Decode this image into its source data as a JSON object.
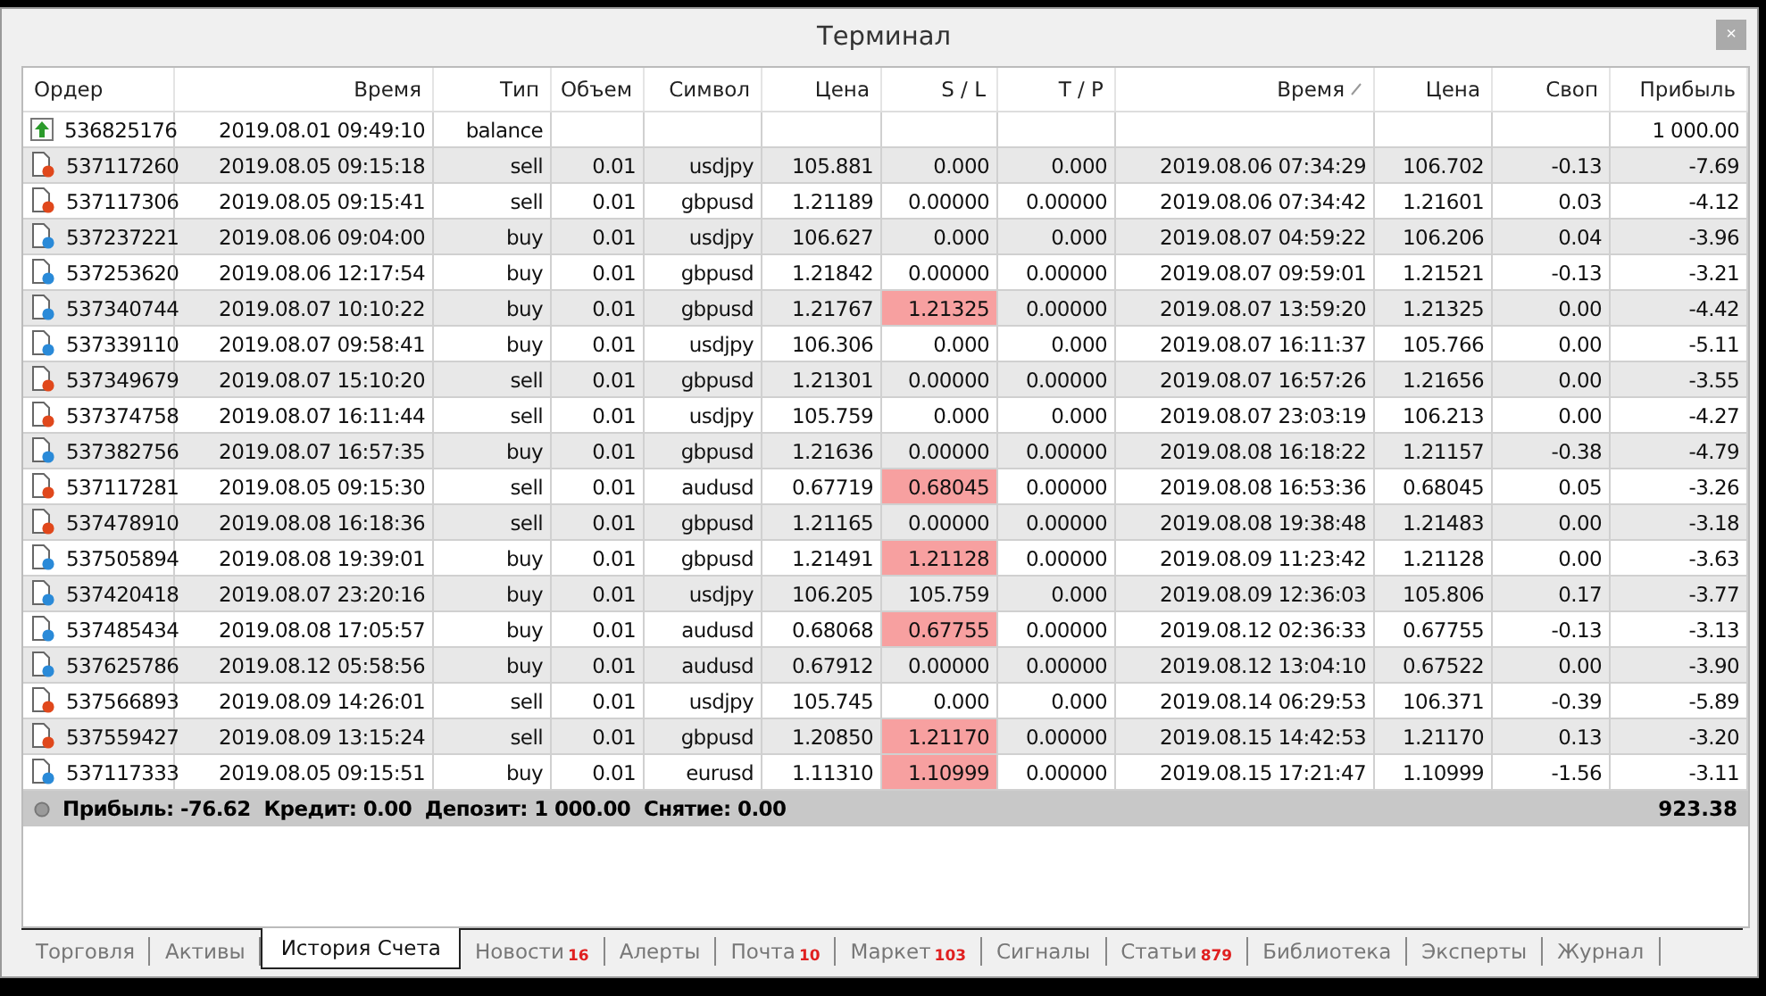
{
  "window": {
    "title": "Терминал",
    "close": "×"
  },
  "columns": [
    {
      "label": "Ордер",
      "sorted": false
    },
    {
      "label": "Время",
      "sorted": false
    },
    {
      "label": "Тип",
      "sorted": false
    },
    {
      "label": "Объем",
      "sorted": false
    },
    {
      "label": "Символ",
      "sorted": false
    },
    {
      "label": "Цена",
      "sorted": false
    },
    {
      "label": "S / L",
      "sorted": false
    },
    {
      "label": "T / P",
      "sorted": false
    },
    {
      "label": "Время",
      "sorted": true
    },
    {
      "label": "Цена",
      "sorted": false
    },
    {
      "label": "Своп",
      "sorted": false
    },
    {
      "label": "Прибыль",
      "sorted": false
    }
  ],
  "rows": [
    {
      "kind": "balance",
      "sl_hit": false,
      "cells": [
        "536825176",
        "2019.08.01 09:49:10",
        "balance",
        null,
        null,
        null,
        null,
        null,
        null,
        null,
        null,
        "1 000.00"
      ]
    },
    {
      "kind": "sell",
      "sl_hit": false,
      "cells": [
        "537117260",
        "2019.08.05 09:15:18",
        "sell",
        "0.01",
        "usdjpy",
        "105.881",
        "0.000",
        "0.000",
        "2019.08.06 07:34:29",
        "106.702",
        "-0.13",
        "-7.69"
      ]
    },
    {
      "kind": "sell",
      "sl_hit": false,
      "cells": [
        "537117306",
        "2019.08.05 09:15:41",
        "sell",
        "0.01",
        "gbpusd",
        "1.21189",
        "0.00000",
        "0.00000",
        "2019.08.06 07:34:42",
        "1.21601",
        "0.03",
        "-4.12"
      ]
    },
    {
      "kind": "buy",
      "sl_hit": false,
      "cells": [
        "537237221",
        "2019.08.06 09:04:00",
        "buy",
        "0.01",
        "usdjpy",
        "106.627",
        "0.000",
        "0.000",
        "2019.08.07 04:59:22",
        "106.206",
        "0.04",
        "-3.96"
      ]
    },
    {
      "kind": "buy",
      "sl_hit": false,
      "cells": [
        "537253620",
        "2019.08.06 12:17:54",
        "buy",
        "0.01",
        "gbpusd",
        "1.21842",
        "0.00000",
        "0.00000",
        "2019.08.07 09:59:01",
        "1.21521",
        "-0.13",
        "-3.21"
      ]
    },
    {
      "kind": "buy",
      "sl_hit": true,
      "cells": [
        "537340744",
        "2019.08.07 10:10:22",
        "buy",
        "0.01",
        "gbpusd",
        "1.21767",
        "1.21325",
        "0.00000",
        "2019.08.07 13:59:20",
        "1.21325",
        "0.00",
        "-4.42"
      ]
    },
    {
      "kind": "buy",
      "sl_hit": false,
      "cells": [
        "537339110",
        "2019.08.07 09:58:41",
        "buy",
        "0.01",
        "usdjpy",
        "106.306",
        "0.000",
        "0.000",
        "2019.08.07 16:11:37",
        "105.766",
        "0.00",
        "-5.11"
      ]
    },
    {
      "kind": "sell",
      "sl_hit": false,
      "cells": [
        "537349679",
        "2019.08.07 15:10:20",
        "sell",
        "0.01",
        "gbpusd",
        "1.21301",
        "0.00000",
        "0.00000",
        "2019.08.07 16:57:26",
        "1.21656",
        "0.00",
        "-3.55"
      ]
    },
    {
      "kind": "sell",
      "sl_hit": false,
      "cells": [
        "537374758",
        "2019.08.07 16:11:44",
        "sell",
        "0.01",
        "usdjpy",
        "105.759",
        "0.000",
        "0.000",
        "2019.08.07 23:03:19",
        "106.213",
        "0.00",
        "-4.27"
      ]
    },
    {
      "kind": "buy",
      "sl_hit": false,
      "cells": [
        "537382756",
        "2019.08.07 16:57:35",
        "buy",
        "0.01",
        "gbpusd",
        "1.21636",
        "0.00000",
        "0.00000",
        "2019.08.08 16:18:22",
        "1.21157",
        "-0.38",
        "-4.79"
      ]
    },
    {
      "kind": "sell",
      "sl_hit": true,
      "cells": [
        "537117281",
        "2019.08.05 09:15:30",
        "sell",
        "0.01",
        "audusd",
        "0.67719",
        "0.68045",
        "0.00000",
        "2019.08.08 16:53:36",
        "0.68045",
        "0.05",
        "-3.26"
      ]
    },
    {
      "kind": "sell",
      "sl_hit": false,
      "cells": [
        "537478910",
        "2019.08.08 16:18:36",
        "sell",
        "0.01",
        "gbpusd",
        "1.21165",
        "0.00000",
        "0.00000",
        "2019.08.08 19:38:48",
        "1.21483",
        "0.00",
        "-3.18"
      ]
    },
    {
      "kind": "buy",
      "sl_hit": true,
      "cells": [
        "537505894",
        "2019.08.08 19:39:01",
        "buy",
        "0.01",
        "gbpusd",
        "1.21491",
        "1.21128",
        "0.00000",
        "2019.08.09 11:23:42",
        "1.21128",
        "0.00",
        "-3.63"
      ]
    },
    {
      "kind": "buy",
      "sl_hit": false,
      "cells": [
        "537420418",
        "2019.08.07 23:20:16",
        "buy",
        "0.01",
        "usdjpy",
        "106.205",
        "105.759",
        "0.000",
        "2019.08.09 12:36:03",
        "105.806",
        "0.17",
        "-3.77"
      ]
    },
    {
      "kind": "buy",
      "sl_hit": true,
      "cells": [
        "537485434",
        "2019.08.08 17:05:57",
        "buy",
        "0.01",
        "audusd",
        "0.68068",
        "0.67755",
        "0.00000",
        "2019.08.12 02:36:33",
        "0.67755",
        "-0.13",
        "-3.13"
      ]
    },
    {
      "kind": "buy",
      "sl_hit": false,
      "cells": [
        "537625786",
        "2019.08.12 05:58:56",
        "buy",
        "0.01",
        "audusd",
        "0.67912",
        "0.00000",
        "0.00000",
        "2019.08.12 13:04:10",
        "0.67522",
        "0.00",
        "-3.90"
      ]
    },
    {
      "kind": "sell",
      "sl_hit": false,
      "cells": [
        "537566893",
        "2019.08.09 14:26:01",
        "sell",
        "0.01",
        "usdjpy",
        "105.745",
        "0.000",
        "0.000",
        "2019.08.14 06:29:53",
        "106.371",
        "-0.39",
        "-5.89"
      ]
    },
    {
      "kind": "sell",
      "sl_hit": true,
      "cells": [
        "537559427",
        "2019.08.09 13:15:24",
        "sell",
        "0.01",
        "gbpusd",
        "1.20850",
        "1.21170",
        "0.00000",
        "2019.08.15 14:42:53",
        "1.21170",
        "0.13",
        "-3.20"
      ]
    },
    {
      "kind": "buy",
      "sl_hit": true,
      "cells": [
        "537117333",
        "2019.08.05 09:15:51",
        "buy",
        "0.01",
        "eurusd",
        "1.11310",
        "1.10999",
        "0.00000",
        "2019.08.15 17:21:47",
        "1.10999",
        "-1.56",
        "-3.11"
      ]
    }
  ],
  "summary": {
    "text": "Прибыль: -76.62  Кредит: 0.00  Депозит: 1 000.00  Снятие: 0.00",
    "total": "923.38"
  },
  "tabs": [
    {
      "label": "Торговля",
      "selected": false
    },
    {
      "label": "Активы",
      "selected": false
    },
    {
      "label": "История Счета",
      "selected": true
    },
    {
      "label": "Новости",
      "badge": "16",
      "selected": false
    },
    {
      "label": "Алерты",
      "selected": false
    },
    {
      "label": "Почта",
      "badge": "10",
      "selected": false
    },
    {
      "label": "Маркет",
      "badge": "103",
      "selected": false
    },
    {
      "label": "Сигналы",
      "selected": false
    },
    {
      "label": "Статьи",
      "badge": "879",
      "selected": false
    },
    {
      "label": "Библиотека",
      "selected": false
    },
    {
      "label": "Эксперты",
      "selected": false
    },
    {
      "label": "Журнал",
      "selected": false
    }
  ]
}
